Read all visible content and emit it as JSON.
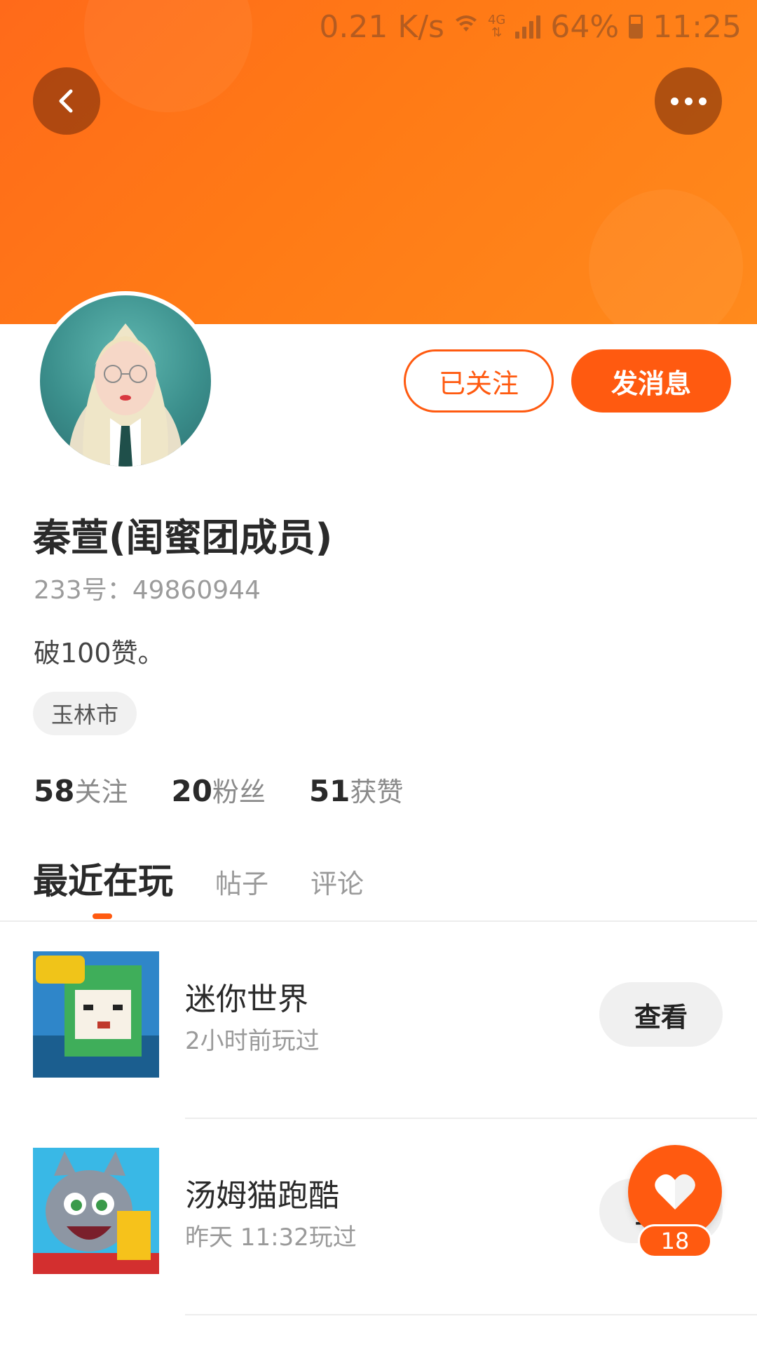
{
  "status_bar": {
    "net_speed": "0.21 K/s",
    "network_type": "4G",
    "battery": "64%",
    "battery_level": 0.64,
    "time": "11:25"
  },
  "header": {
    "back_icon": "chevron-left-icon",
    "more_icon": "more-dots-icon",
    "banner_color": "#ff7a16"
  },
  "profile": {
    "name": "秦萱(闺蜜团成员)",
    "id_line": "233号：49860944",
    "bio": "破100赞。",
    "location": "玉林市",
    "follow_label": "已关注",
    "message_label": "发消息",
    "accent_color": "#ff5a10"
  },
  "stats": [
    {
      "number": "58",
      "label": "关注"
    },
    {
      "number": "20",
      "label": "粉丝"
    },
    {
      "number": "51",
      "label": "获赞"
    }
  ],
  "tabs": [
    {
      "label": "最近在玩",
      "active": true
    },
    {
      "label": "帖子",
      "active": false
    },
    {
      "label": "评论",
      "active": false
    }
  ],
  "games": [
    {
      "title": "迷你世界",
      "subtitle": "2小时前玩过",
      "button": "查看"
    },
    {
      "title": "汤姆猫跑酷",
      "subtitle": "昨天 11:32玩过",
      "button": "查看"
    }
  ],
  "like_fab": {
    "icon": "heart-icon",
    "count": "18"
  }
}
